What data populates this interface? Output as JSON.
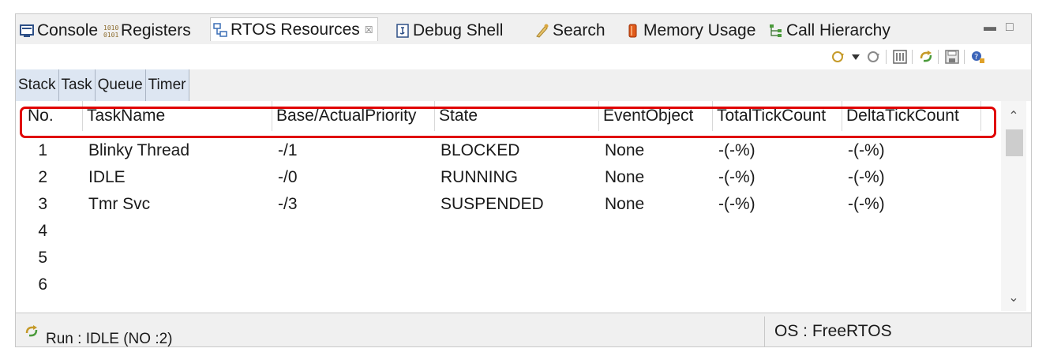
{
  "tabs": [
    {
      "label": "Console",
      "icon": "console-icon"
    },
    {
      "label": "Registers",
      "icon": "registers-icon"
    },
    {
      "label": "RTOS Resources",
      "icon": "rtos-resources-icon",
      "active": true
    },
    {
      "label": "Debug Shell",
      "icon": "debug-shell-icon"
    },
    {
      "label": "Search",
      "icon": "search-icon"
    },
    {
      "label": "Memory Usage",
      "icon": "memory-usage-icon"
    },
    {
      "label": "Call Hierarchy",
      "icon": "call-hierarchy-icon"
    }
  ],
  "close_glyph": "☒",
  "inner_tabs": [
    "Stack",
    "Task",
    "Queue",
    "Timer"
  ],
  "table": {
    "columns": [
      "No.",
      "TaskName",
      "Base/ActualPriority",
      "State",
      "EventObject",
      "TotalTickCount",
      "DeltaTickCount"
    ],
    "rows": [
      {
        "no": "1",
        "name": "Blinky Thread",
        "priority": "-/1",
        "state": "BLOCKED",
        "event": "None",
        "total": "-(-%)",
        "delta": "-(-%)"
      },
      {
        "no": "2",
        "name": "IDLE",
        "priority": "-/0",
        "state": "RUNNING",
        "event": "None",
        "total": "-(-%)",
        "delta": "-(-%)"
      },
      {
        "no": "3",
        "name": "Tmr Svc",
        "priority": "-/3",
        "state": "SUSPENDED",
        "event": "None",
        "total": "-(-%)",
        "delta": "-(-%)"
      },
      {
        "no": "4",
        "name": "",
        "priority": "",
        "state": "",
        "event": "",
        "total": "",
        "delta": ""
      },
      {
        "no": "5",
        "name": "",
        "priority": "",
        "state": "",
        "event": "",
        "total": "",
        "delta": ""
      },
      {
        "no": "6",
        "name": "",
        "priority": "",
        "state": "",
        "event": "",
        "total": "",
        "delta": ""
      }
    ]
  },
  "status": {
    "run": "Run : IDLE (NO :2)",
    "os": "OS : FreeRTOS"
  },
  "colors": {
    "highlight": "#e00000",
    "inner_tab_bg": "#dde6f2"
  }
}
